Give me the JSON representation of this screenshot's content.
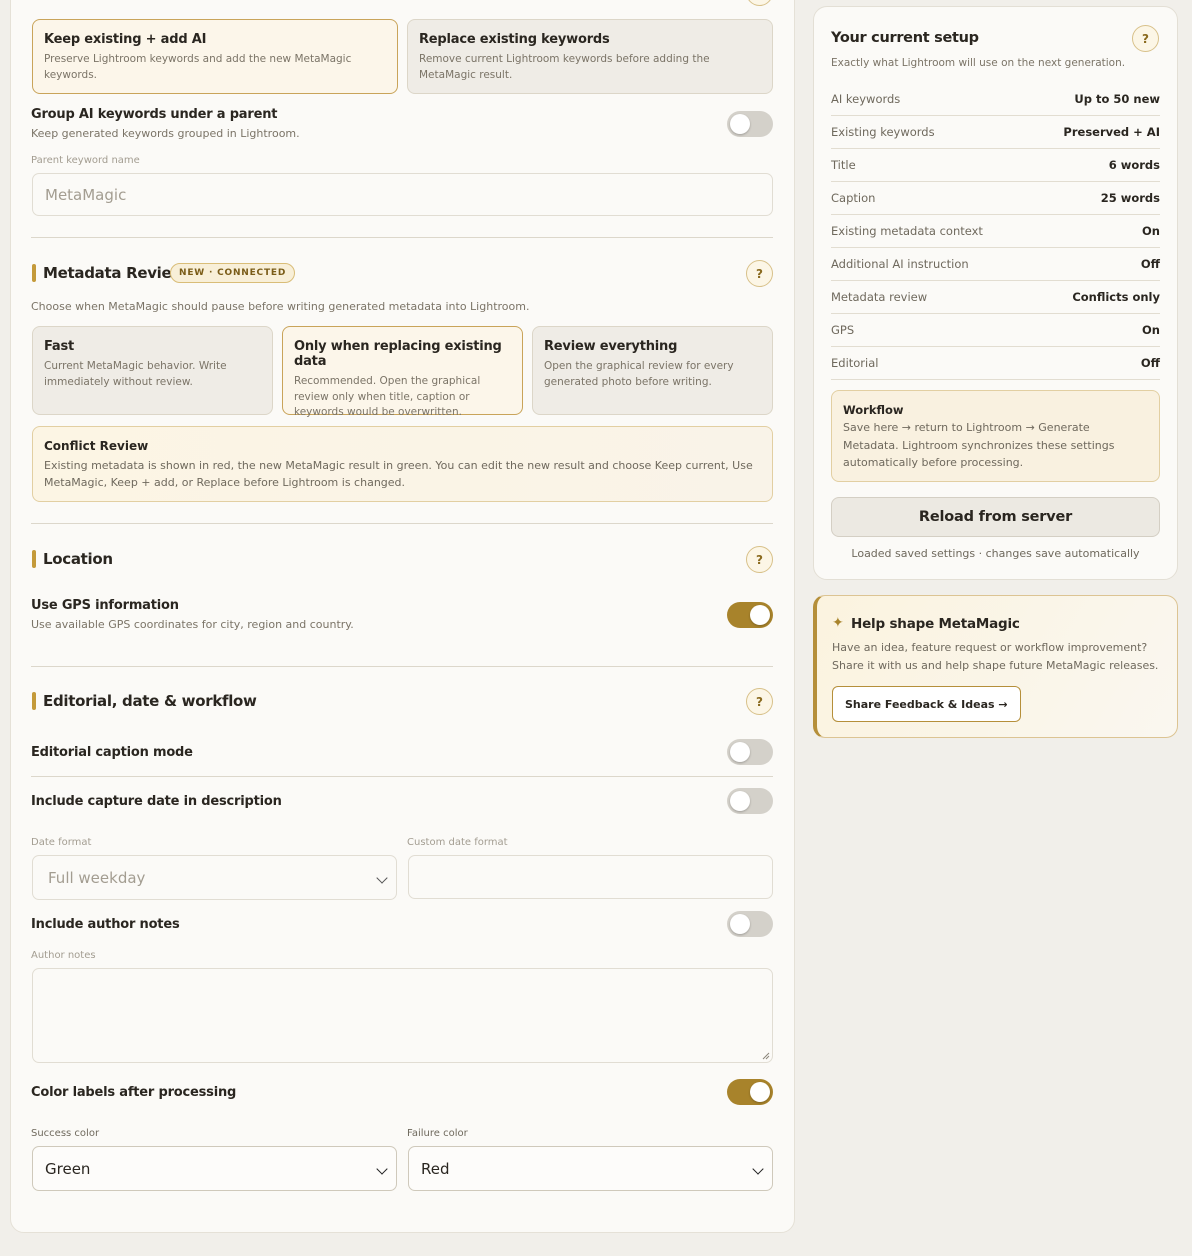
{
  "keyword_mode": {
    "options": [
      {
        "title": "Keep existing + add AI",
        "desc": "Preserve Lightroom keywords and add the new MetaMagic keywords."
      },
      {
        "title": "Replace existing keywords",
        "desc": "Remove current Lightroom keywords before adding the MetaMagic result."
      }
    ],
    "selected": 0
  },
  "group_keywords": {
    "title": "Group AI keywords under a parent",
    "desc": "Keep generated keywords grouped in Lightroom.",
    "enabled": false
  },
  "parent_keyword": {
    "label": "Parent keyword name",
    "placeholder": "MetaMagic"
  },
  "metadata_review": {
    "title": "Metadata Review",
    "badge": "NEW · CONNECTED",
    "help": "?",
    "intro": "Choose when MetaMagic should pause before writing generated metadata into Lightroom.",
    "options": [
      {
        "title": "Fast",
        "desc": "Current MetaMagic behavior. Write immediately without review."
      },
      {
        "title": "Only when replacing existing data",
        "desc": "Recommended. Open the graphical review only when title, caption or keywords would be overwritten."
      },
      {
        "title": "Review everything",
        "desc": "Open the graphical review for every generated photo before writing."
      }
    ],
    "selected": 1,
    "conflict_title": "Conflict Review",
    "conflict_desc": "Existing metadata is shown in red, the new MetaMagic result in green. You can edit the new result and choose Keep current, Use MetaMagic, Keep + add, or Replace before Lightroom is changed."
  },
  "location": {
    "title": "Location",
    "help": "?",
    "gps_title": "Use GPS information",
    "gps_desc": "Use available GPS coordinates for city, region and country.",
    "gps_enabled": true
  },
  "editorial": {
    "title": "Editorial, date & workflow",
    "help": "?",
    "caption_mode": {
      "title": "Editorial caption mode",
      "enabled": false
    },
    "capture_date": {
      "title": "Include capture date in description",
      "enabled": false
    },
    "date_format_label": "Date format",
    "date_format_value": "Full weekday",
    "custom_format_label": "Custom date format",
    "custom_format_value": "",
    "author_notes": {
      "title": "Include author notes",
      "enabled": false
    },
    "author_notes_label": "Author notes",
    "author_notes_value": "",
    "color_labels": {
      "title": "Color labels after processing",
      "enabled": true
    },
    "success_label": "Success color",
    "success_value": "Green",
    "failure_label": "Failure color",
    "failure_value": "Red"
  },
  "setup": {
    "title": "Your current setup",
    "help": "?",
    "subtitle": "Exactly what Lightroom will use on the next generation.",
    "rows": [
      {
        "k": "AI keywords",
        "v": "Up to 50 new"
      },
      {
        "k": "Existing keywords",
        "v": "Preserved + AI"
      },
      {
        "k": "Title",
        "v": "6 words"
      },
      {
        "k": "Caption",
        "v": "25 words"
      },
      {
        "k": "Existing metadata context",
        "v": "On"
      },
      {
        "k": "Additional AI instruction",
        "v": "Off"
      },
      {
        "k": "Metadata review",
        "v": "Conflicts only"
      },
      {
        "k": "GPS",
        "v": "On"
      },
      {
        "k": "Editorial",
        "v": "Off"
      }
    ],
    "workflow_title": "Workflow",
    "workflow_desc": "Save here → return to Lightroom → Generate Metadata. Lightroom synchronizes these settings automatically before processing.",
    "reload_label": "Reload from server",
    "status": "Loaded saved settings · changes save automatically"
  },
  "feedback": {
    "icon": "✦",
    "title": "Help shape MetaMagic",
    "desc": "Have an idea, feature request or workflow improvement? Share it with us and help shape future MetaMagic releases.",
    "button": "Share Feedback & Ideas →"
  }
}
